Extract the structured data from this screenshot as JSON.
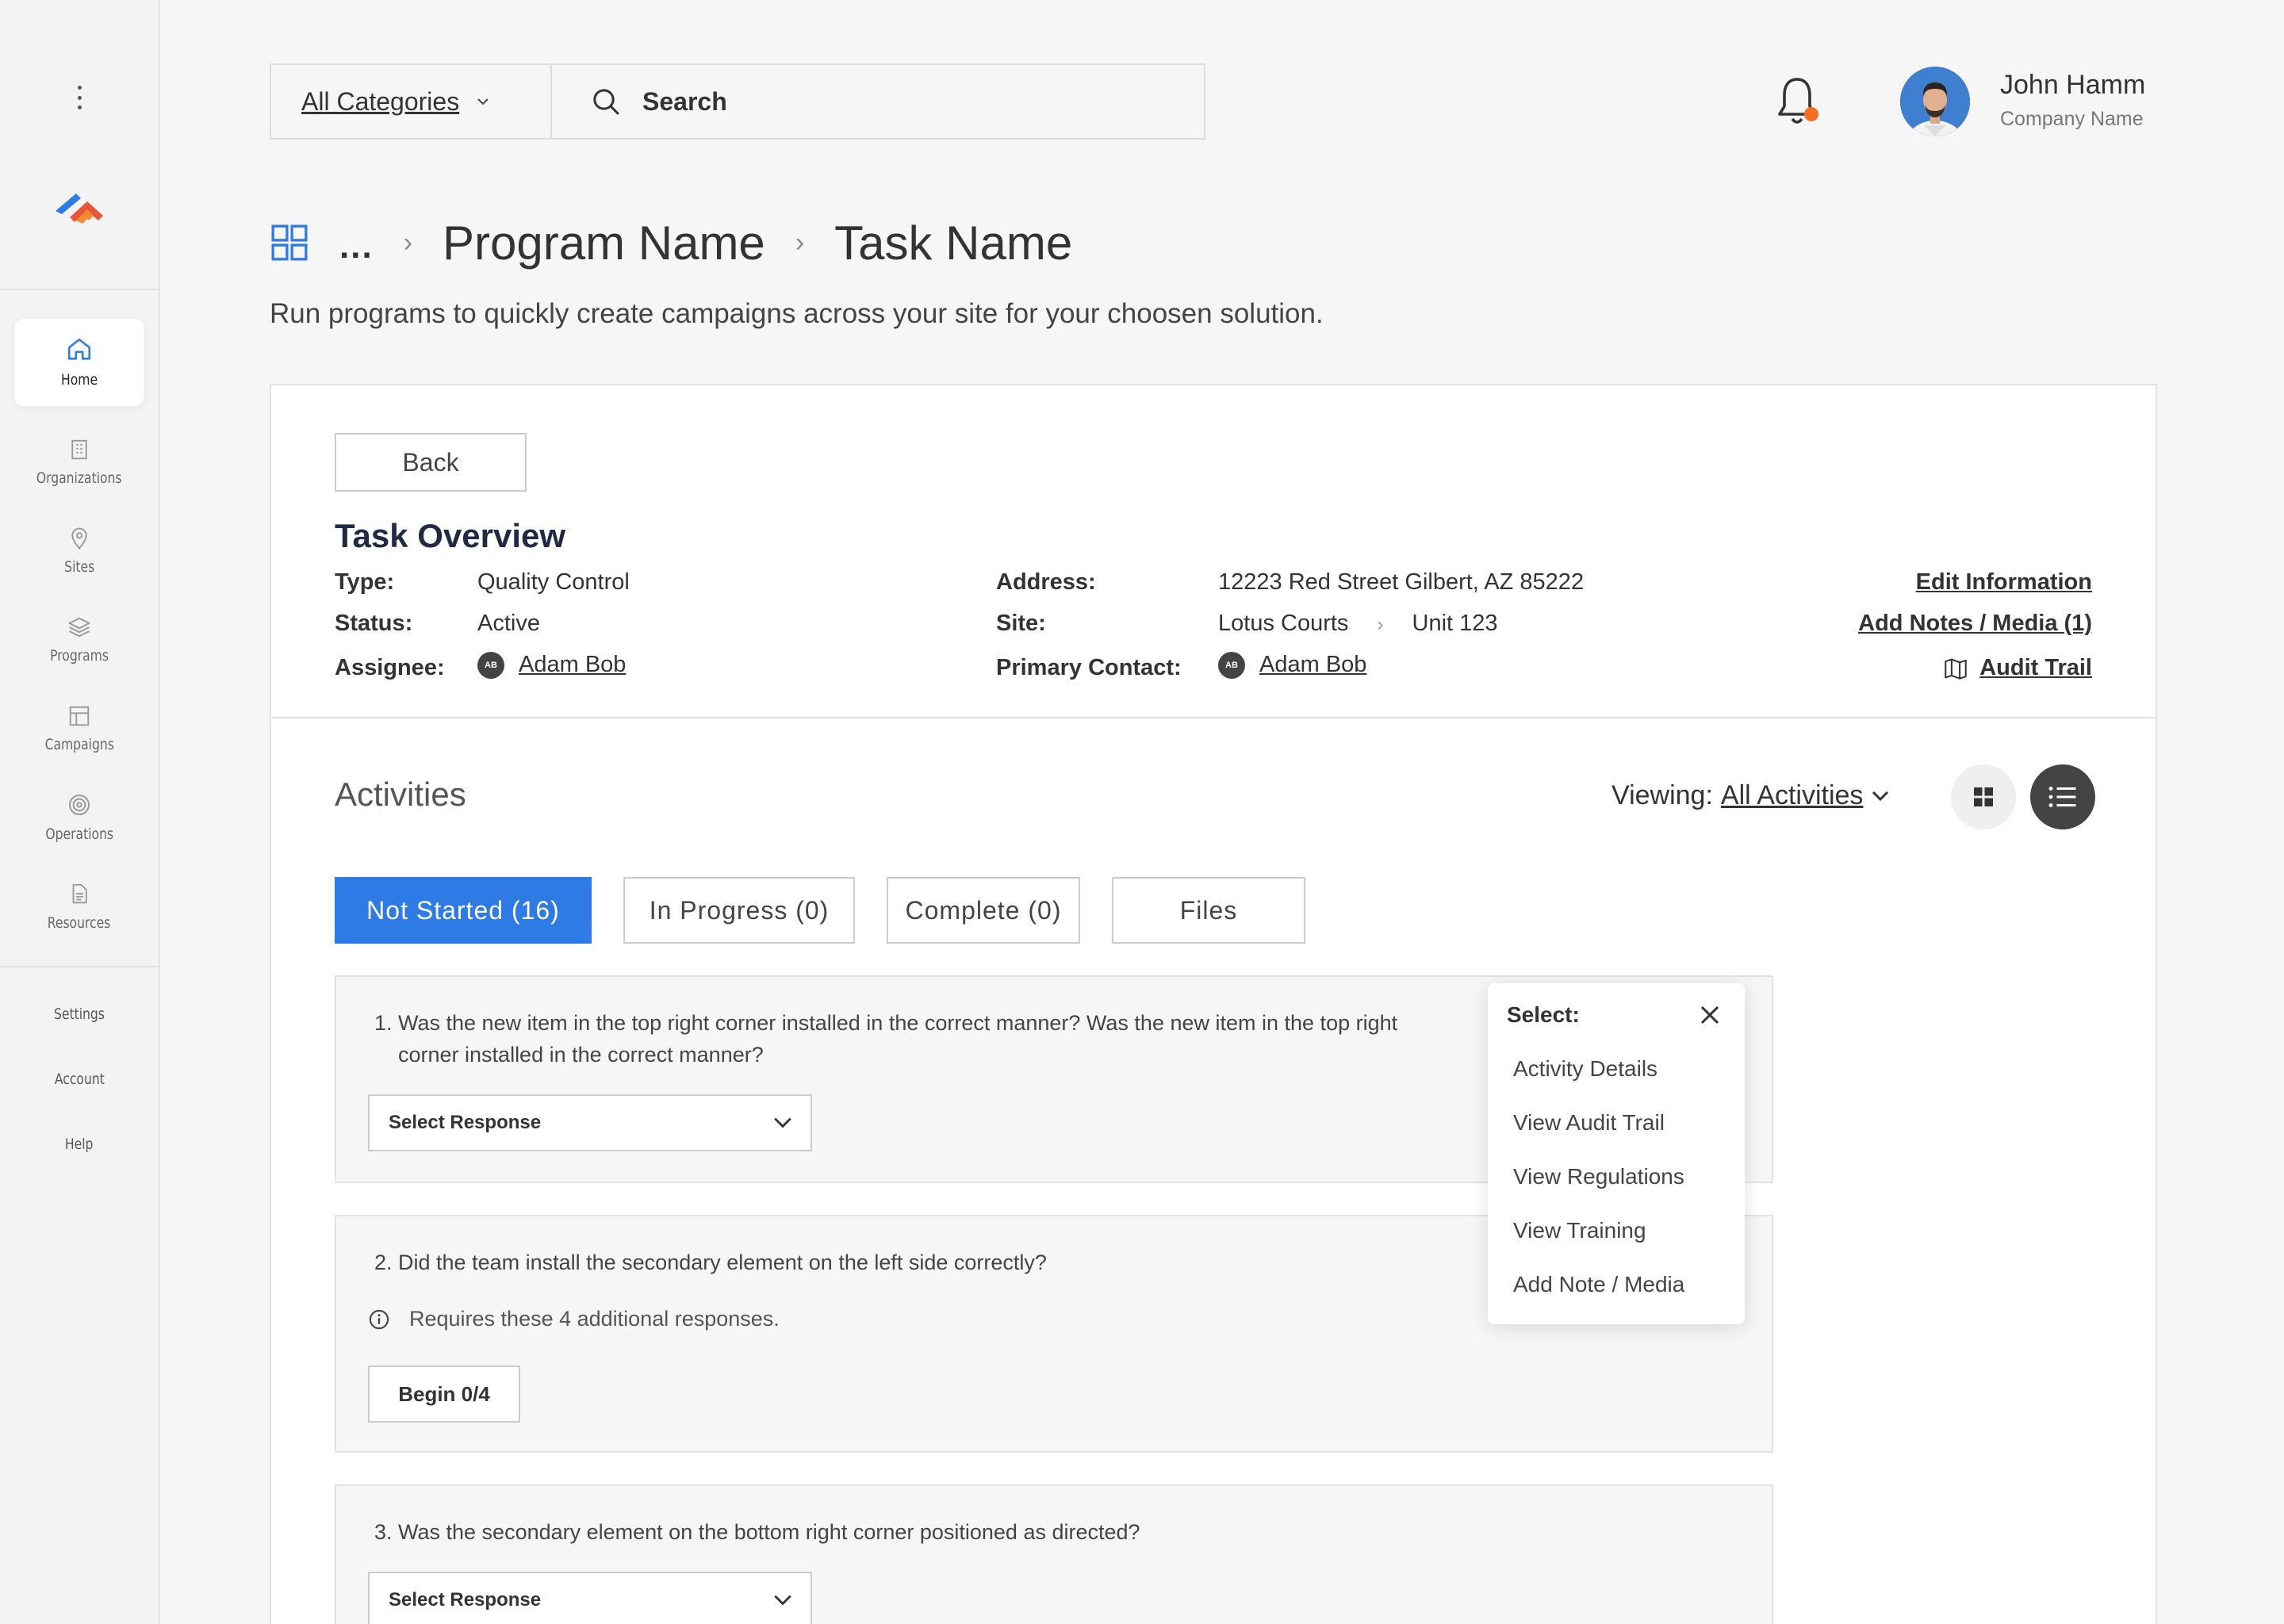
{
  "sidebar": {
    "items": [
      {
        "label": "Home",
        "icon": "home-icon"
      },
      {
        "label": "Organizations",
        "icon": "building-icon"
      },
      {
        "label": "Sites",
        "icon": "map-pin-icon"
      },
      {
        "label": "Programs",
        "icon": "layers-icon"
      },
      {
        "label": "Campaigns",
        "icon": "layout-icon"
      },
      {
        "label": "Operations",
        "icon": "target-icon"
      },
      {
        "label": "Resources",
        "icon": "document-icon"
      }
    ],
    "links": {
      "settings": "Settings",
      "account": "Account",
      "help": "Help"
    }
  },
  "header": {
    "category_label": "All Categories",
    "search_label": "Search",
    "user_name": "John Hamm",
    "user_company": "Company Name",
    "notification_color": "#f07020"
  },
  "breadcrumb": {
    "ellipsis": "...",
    "program": "Program Name",
    "task": "Task Name"
  },
  "subtitle": "Run programs to quickly create campaigns across your site for your choosen solution.",
  "overview": {
    "back_label": "Back",
    "title": "Task Overview",
    "type_label": "Type:",
    "type_value": "Quality Control",
    "status_label": "Status:",
    "status_value": "Active",
    "assignee_label": "Assignee:",
    "assignee_initials": "AB",
    "assignee_name": "Adam Bob",
    "address_label": "Address:",
    "address_value": "12223 Red Street Gilbert, AZ 85222",
    "site_label": "Site:",
    "site_value": "Lotus Courts",
    "site_unit": "Unit 123",
    "contact_label": "Primary Contact:",
    "contact_initials": "AB",
    "contact_name": "Adam Bob",
    "edit_link": "Edit Information",
    "notes_link": "Add Notes / Media (1)",
    "audit_link": "Audit Trail"
  },
  "activities": {
    "title": "Activities",
    "viewing_label": "Viewing:",
    "viewing_value": "All Activities",
    "tabs": [
      "Not Started (16)",
      "In Progress (0)",
      "Complete (0)",
      "Files"
    ],
    "accent": "#2f7be5",
    "questions": [
      {
        "line1": "1.  Was the new item in the top right corner installed in the correct manner? Was the new item in the top right",
        "line2": "corner installed in the correct manner?",
        "select": "Select Response"
      },
      {
        "line1": "2.  Did the team install the secondary element on the left side correctly?",
        "note": "Requires these 4 additional responses.",
        "button": "Begin 0/4"
      },
      {
        "line1": "3.  Was the secondary element on the bottom right corner positioned as directed?",
        "select": "Select Response"
      }
    ]
  },
  "menu": {
    "title": "Select:",
    "items": [
      "Activity Details",
      "View Audit Trail",
      "View Regulations",
      "View Training",
      "Add Note / Media"
    ]
  }
}
